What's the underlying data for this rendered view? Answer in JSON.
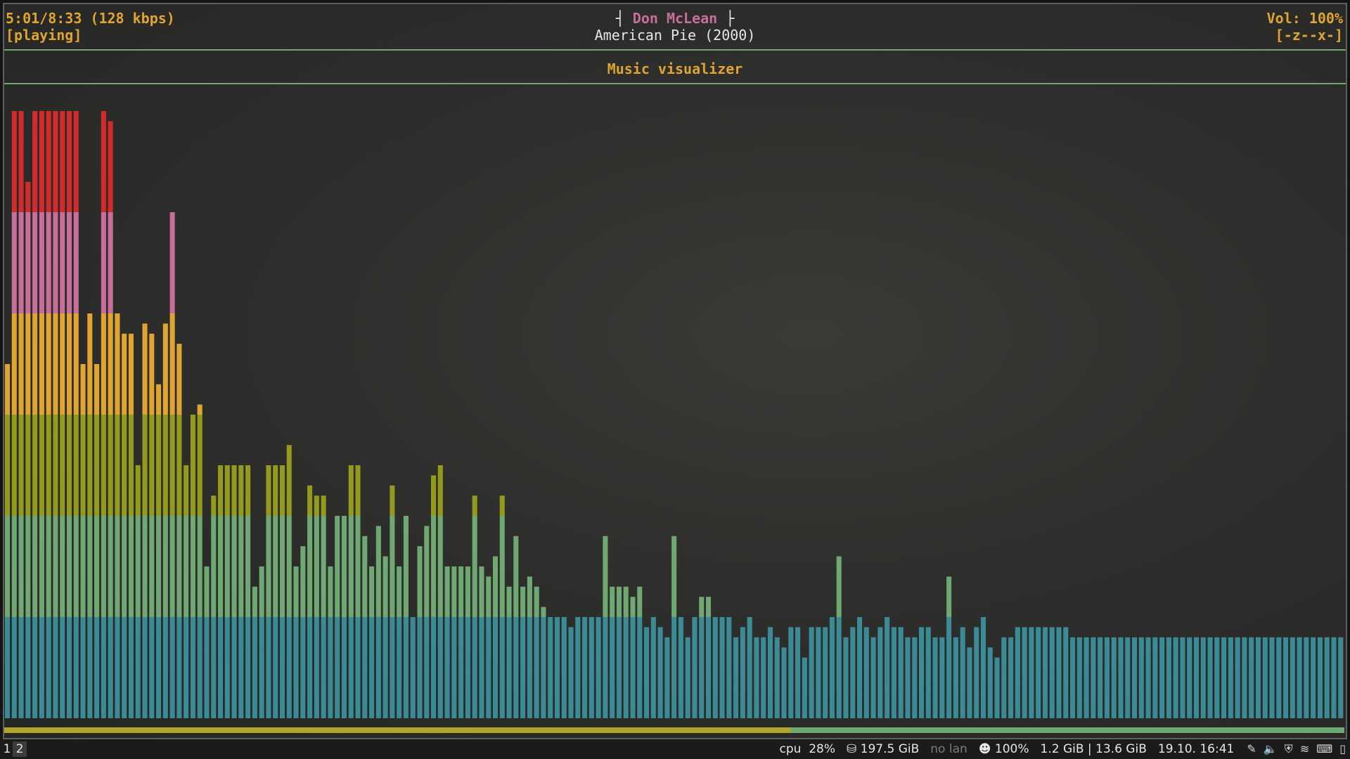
{
  "player": {
    "time": "5:01/8:33 (128 kbps)",
    "state": "[playing]",
    "artist_left": "┤ ",
    "artist": "Don McLean",
    "artist_right": " ├",
    "album": "American Pie (2000)",
    "volume": "Vol: 100%",
    "flags": "[-z--x-]",
    "screen_title": "Music visualizer",
    "progress_fraction": 0.587
  },
  "colors": {
    "orange": "#e0a431",
    "pink": "#c86e9a",
    "separator": "#6fa873",
    "progress_played": "#b0a62a",
    "band_colors": [
      "#3b8b96",
      "#6fa873",
      "#939a1d",
      "#e0a431",
      "#c86e9a",
      "#d22b2b"
    ]
  },
  "chart_data": {
    "type": "bar",
    "levels_scale": 6,
    "values": [
      3.5,
      6,
      6,
      5.3,
      6,
      6,
      6,
      6,
      6,
      6,
      6,
      3.5,
      4,
      3.5,
      6,
      5.9,
      4,
      3.8,
      3.8,
      2.5,
      3.9,
      3.8,
      3.3,
      3.9,
      5,
      3.7,
      2.5,
      3,
      3.1,
      1.5,
      2.2,
      2.5,
      2.5,
      2.5,
      2.5,
      2.5,
      1.3,
      1.5,
      2.5,
      2.5,
      2.5,
      2.7,
      1.5,
      1.7,
      2.3,
      2.2,
      2.2,
      1.5,
      2,
      2,
      2.5,
      2.5,
      1.8,
      1.5,
      1.9,
      1.6,
      2.3,
      1.5,
      2,
      1,
      1.7,
      1.9,
      2.4,
      2.5,
      1.5,
      1.5,
      1.5,
      1.5,
      2.2,
      1.5,
      1.4,
      1.6,
      2.2,
      1.3,
      1.8,
      1.3,
      1.4,
      1.3,
      1.1,
      1,
      1,
      1,
      0.9,
      1,
      1,
      1,
      1,
      1.8,
      1.3,
      1.3,
      1.3,
      1.2,
      1.3,
      0.9,
      1,
      0.9,
      0.8,
      1.8,
      1,
      0.8,
      1,
      1.2,
      1.2,
      1,
      1,
      1,
      0.8,
      0.9,
      1,
      0.8,
      0.8,
      0.9,
      0.8,
      0.7,
      0.9,
      0.9,
      0.6,
      0.9,
      0.9,
      0.9,
      1,
      1.6,
      0.8,
      0.9,
      1,
      0.9,
      0.8,
      0.9,
      1,
      0.9,
      0.9,
      0.8,
      0.8,
      0.9,
      0.9,
      0.8,
      0.8,
      1.4,
      0.8,
      0.9,
      0.7,
      0.9,
      1,
      0.7,
      0.6,
      0.8,
      0.8,
      0.9,
      0.9,
      0.9,
      0.9,
      0.9,
      0.9,
      0.9,
      0.9,
      0.8,
      0.8,
      0.8,
      0.8,
      0.8,
      0.8,
      0.8,
      0.8,
      0.8,
      0.8,
      0.8,
      0.8,
      0.8,
      0.8,
      0.8,
      0.8,
      0.8,
      0.8,
      0.8,
      0.8,
      0.8,
      0.8,
      0.8,
      0.8,
      0.8,
      0.8,
      0.8,
      0.8,
      0.8,
      0.8,
      0.8,
      0.8,
      0.8,
      0.8,
      0.8,
      0.8,
      0.8,
      0.8,
      0.8,
      0.8
    ]
  },
  "statusbar": {
    "workspace_1": "1",
    "workspace_2": "2",
    "cpu": "cpu  28%",
    "disk": "⛁ 197.5 GiB",
    "network": "no lan",
    "battery": "☻ 100%",
    "memory": "1.2 GiB | 13.6 GiB",
    "datetime": "19.10. 16:41",
    "tray_icons": [
      "paperclip-icon",
      "speaker-icon",
      "shield-icon",
      "wifi-icon",
      "keyboard-icon",
      "mouse-icon"
    ]
  }
}
